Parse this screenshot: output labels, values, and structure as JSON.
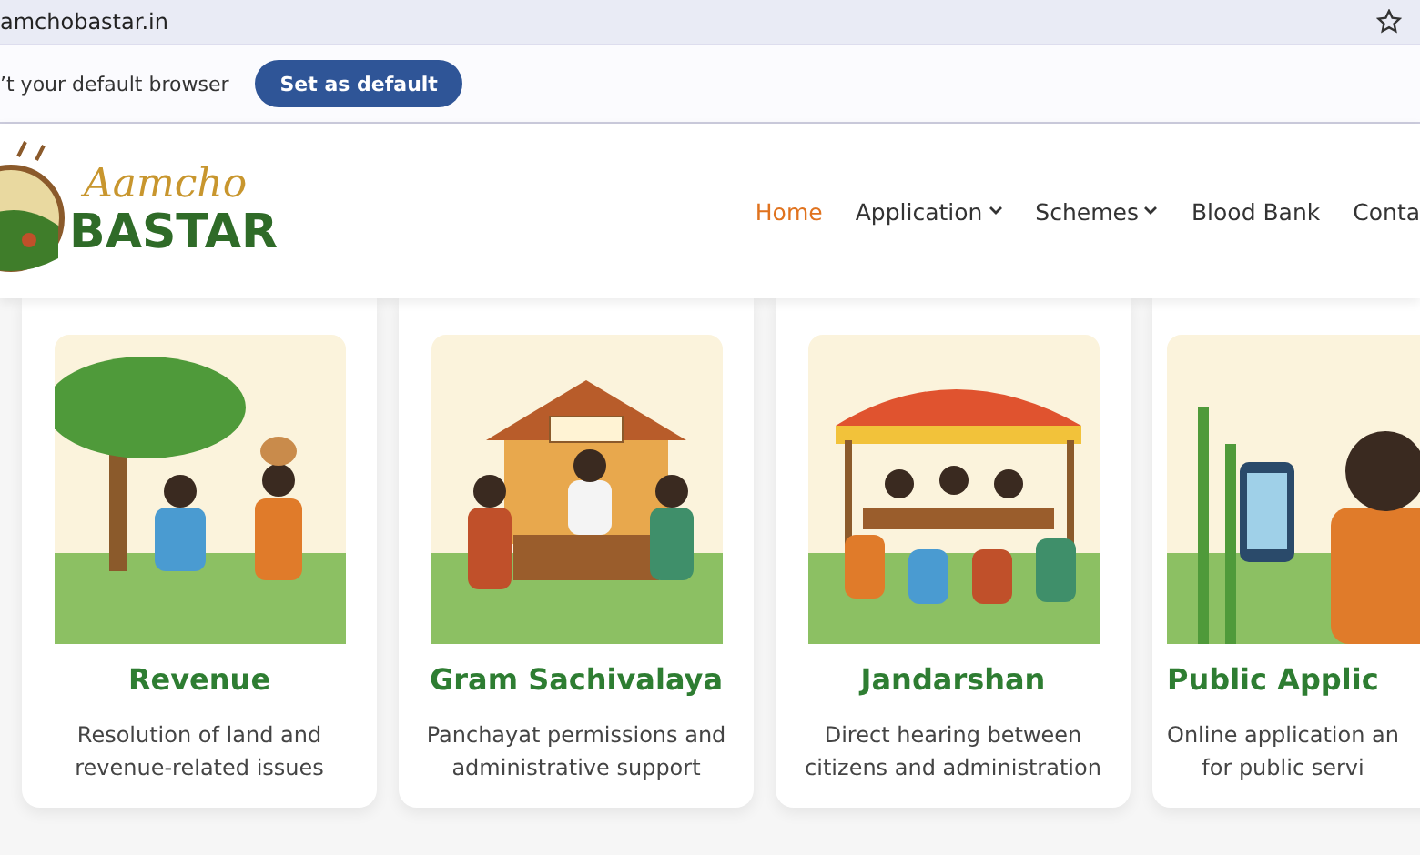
{
  "address_bar": {
    "url": "amchobastar.in"
  },
  "infobar": {
    "message": "’t your default browser",
    "button": "Set as default"
  },
  "header": {
    "logo": {
      "line1": "Aamcho",
      "line2": "BASTAR"
    },
    "nav": [
      {
        "label": "Home",
        "selected": true,
        "dropdown": false
      },
      {
        "label": "Application",
        "selected": false,
        "dropdown": true
      },
      {
        "label": "Schemes",
        "selected": false,
        "dropdown": true
      },
      {
        "label": "Blood Bank",
        "selected": false,
        "dropdown": false
      },
      {
        "label": "Conta",
        "selected": false,
        "dropdown": false
      }
    ]
  },
  "cards": [
    {
      "title": "Revenue",
      "description": "Resolution of land and revenue-related issues"
    },
    {
      "title": "Gram Sachivalaya",
      "description": "Panchayat permissions and administrative support"
    },
    {
      "title": "Jandarshan",
      "description": "Direct hearing between citizens and administration"
    },
    {
      "title": "Public Applic",
      "description": "Online application an\nfor public servi"
    }
  ]
}
